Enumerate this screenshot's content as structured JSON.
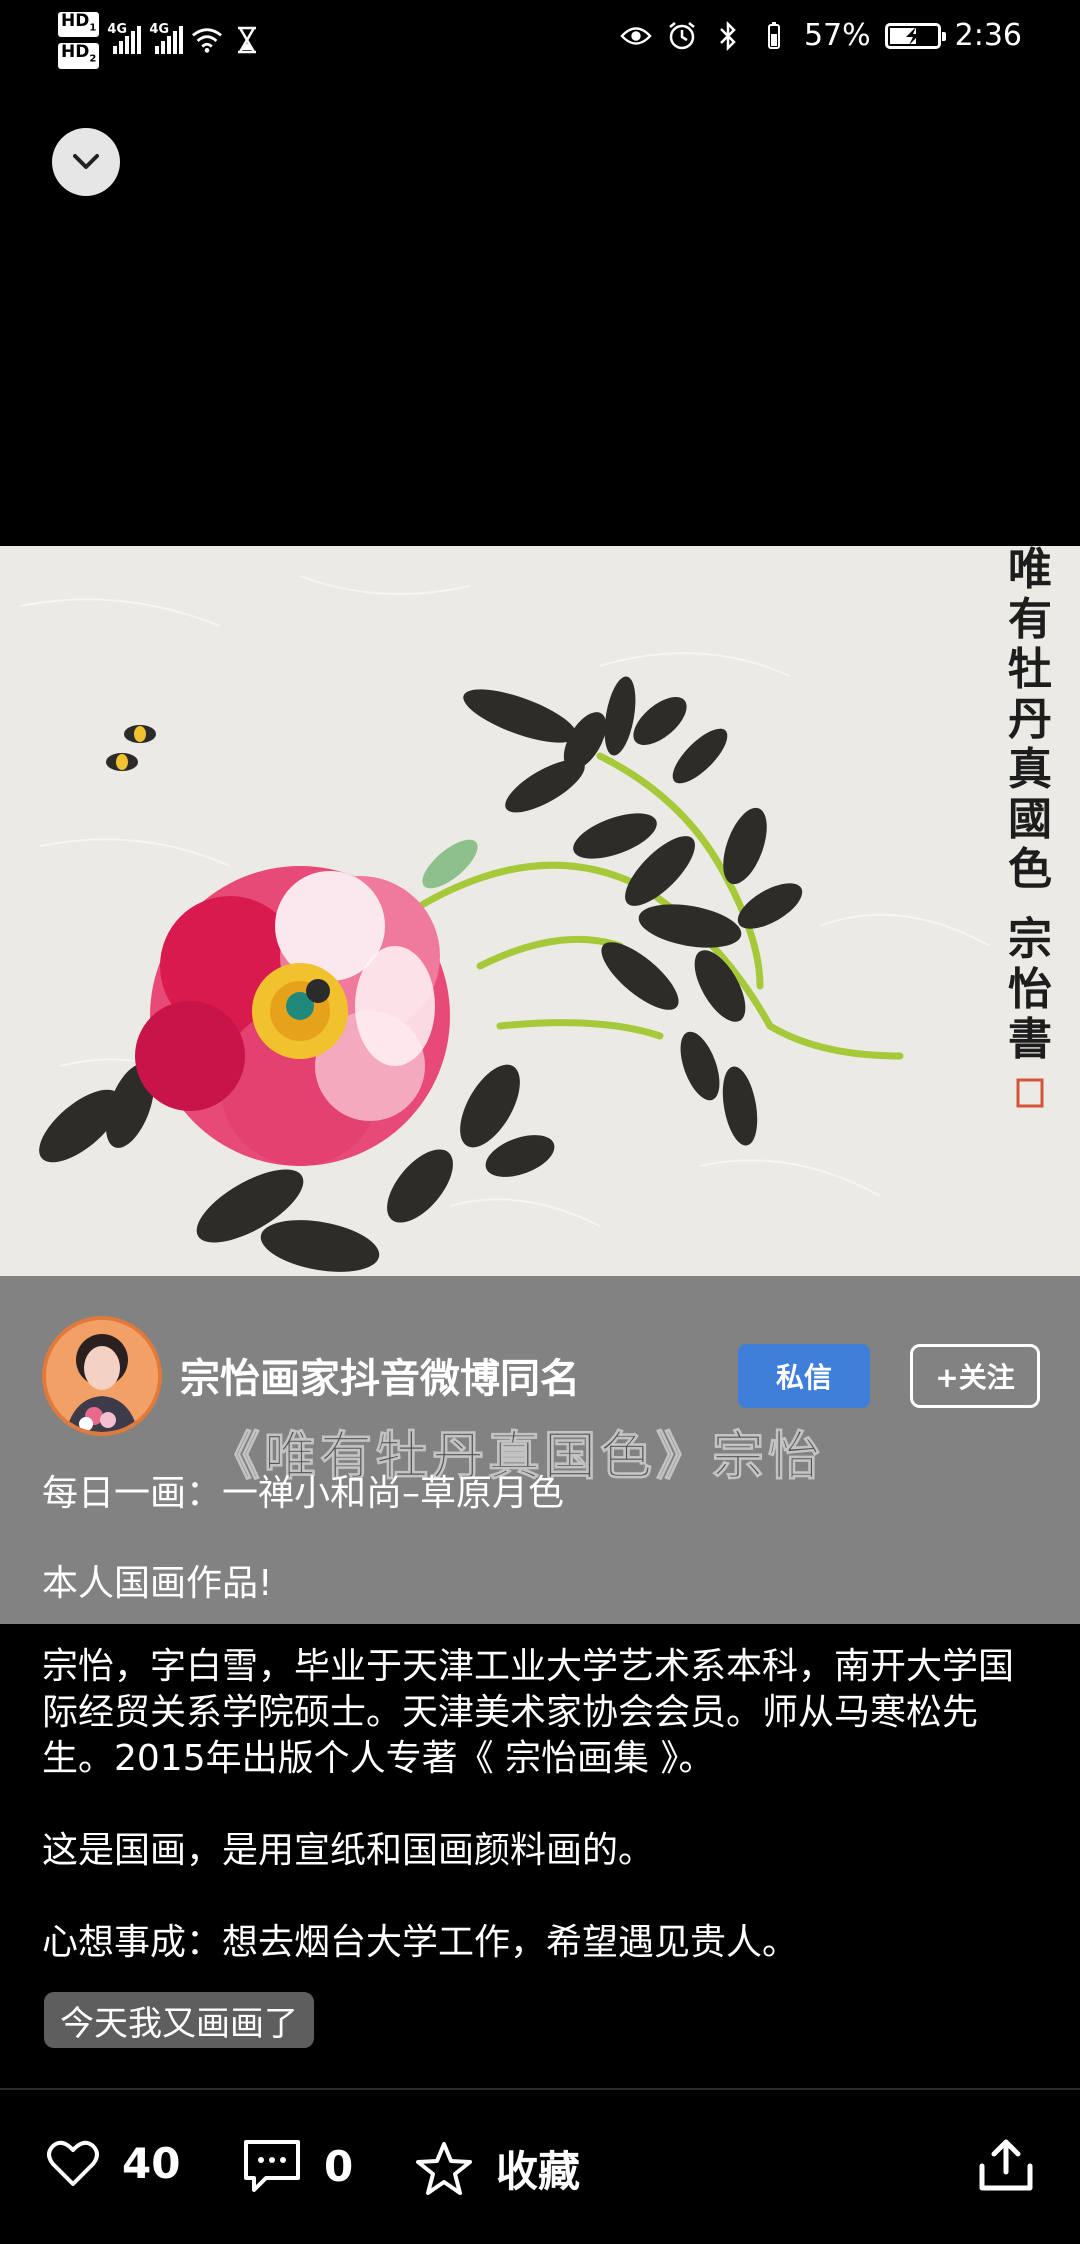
{
  "status_bar": {
    "hd1": "HD",
    "hd1_sub": "1",
    "hd2": "HD",
    "hd2_sub": "2",
    "net1": "4G",
    "net2": "4G",
    "battery_percent": "57%",
    "battery_level": 0.57,
    "time": "2:36"
  },
  "post": {
    "author_name": "宗怡画家抖音微博同名",
    "dm_label": "私信",
    "follow_label": "+关注",
    "painting_title_overlay": "《唯有牡丹真国色》宗怡",
    "painting_inscription": "唯有牡丹真國色",
    "painting_signature": "宗怡書",
    "daily_line": "每日一画：一禅小和尚–草原月色",
    "self_line": "本人国画作品!",
    "description_1": "宗怡，字白雪，毕业于天津工业大学艺术系本科，南开大学国际经贸关系学院硕士。天津美术家协会会员。师从马寒松先生。2015年出版个人专著《 宗怡画集 》。",
    "description_2": "这是国画，是用宣纸和国画颜料画的。",
    "description_3": "心想事成：想去烟台大学工作，希望遇见贵人。",
    "tag": "今天我又画画了"
  },
  "actions": {
    "like_count": "40",
    "comment_count": "0",
    "favorite_label": "收藏"
  }
}
